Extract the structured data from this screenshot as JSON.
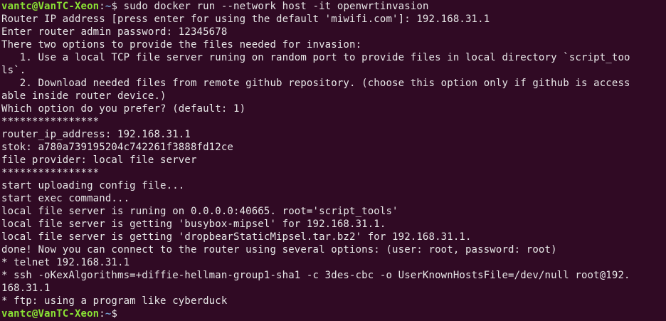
{
  "prompt": {
    "user_host": "vantc@VanTC-Xeon",
    "path": "~",
    "symbol": "$ "
  },
  "command": "sudo docker run --network host -it openwrtinvasion",
  "output": [
    "Router IP address [press enter for using the default 'miwifi.com']: 192.168.31.1",
    "Enter router admin password: 12345678",
    "There two options to provide the files needed for invasion:",
    "   1. Use a local TCP file server runing on random port to provide files in local directory `script_too",
    "ls`.",
    "   2. Download needed files from remote github repository. (choose this option only if github is access",
    "able inside router device.)",
    "Which option do you prefer? (default: 1)",
    "****************",
    "router_ip_address: 192.168.31.1",
    "stok: a780a739195204c742261f3888fd12ce",
    "file provider: local file server",
    "****************",
    "start uploading config file...",
    "start exec command...",
    "local file server is runing on 0.0.0.0:40665. root='script_tools'",
    "local file server is getting 'busybox-mipsel' for 192.168.31.1.",
    "local file server is getting 'dropbearStaticMipsel.tar.bz2' for 192.168.31.1.",
    "done! Now you can connect to the router using several options: (user: root, password: root)",
    "* telnet 192.168.31.1",
    "* ssh -oKexAlgorithms=+diffie-hellman-group1-sha1 -c 3des-cbc -o UserKnownHostsFile=/dev/null root@192.",
    "168.31.1",
    "* ftp: using a program like cyberduck"
  ],
  "colors": {
    "background": "#300a24",
    "text": "#e8e8e8",
    "user_host": "#8ae234",
    "path": "#729fcf"
  }
}
